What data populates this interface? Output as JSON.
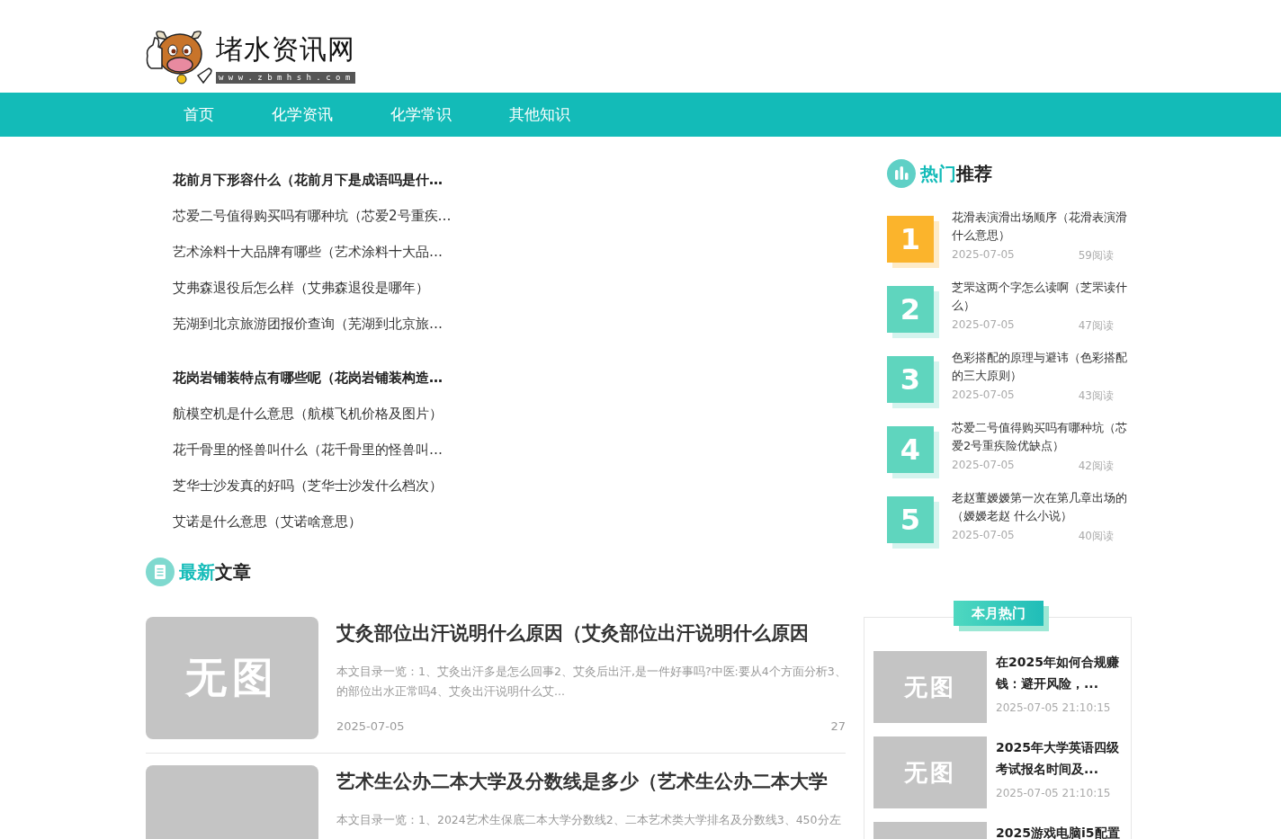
{
  "logo": {
    "name": "堵水资讯网",
    "domain": "w w w . z b m h s h . c o m"
  },
  "nav": [
    {
      "label": "首页"
    },
    {
      "label": "化学资讯"
    },
    {
      "label": "化学常识"
    },
    {
      "label": "其他知识"
    }
  ],
  "link_groups": [
    {
      "items": [
        {
          "text": "花前月下形容什么（花前月下是成语吗是什…",
          "bold": true
        },
        {
          "text": "芯爱二号值得购买吗有哪种坑（芯爱2号重疾…",
          "bold": false
        },
        {
          "text": "艺术涂料十大品牌有哪些（艺术涂料十大品…",
          "bold": false
        },
        {
          "text": "艾弗森退役后怎么样（艾弗森退役是哪年）",
          "bold": false
        },
        {
          "text": "芜湖到北京旅游团报价查询（芜湖到北京旅…",
          "bold": false
        }
      ]
    },
    {
      "items": [
        {
          "text": "花岗岩铺装特点有哪些呢（花岗岩铺装构造…",
          "bold": true
        },
        {
          "text": "航模空机是什么意思（航模飞机价格及图片）",
          "bold": false
        },
        {
          "text": "花千骨里的怪兽叫什么（花千骨里的怪兽叫…",
          "bold": false
        },
        {
          "text": "芝华士沙发真的好吗（芝华士沙发什么档次）",
          "bold": false
        },
        {
          "text": "艾诺是什么意思（艾诺啥意思）",
          "bold": false
        }
      ]
    }
  ],
  "latest": {
    "title_accent": "最新",
    "title_rest": "文章",
    "articles": [
      {
        "image_label": "无图",
        "title": "艾灸部位出汗说明什么原因（艾灸部位出汗说明什么原因",
        "excerpt_lines": [
          "本文目录一览：1、艾灸出汗多是怎么回事2、艾灸后出汗,是一件好事吗?中医:要从4个方面分析3、",
          "的部位出水正常吗4、艾灸出汗说明什么艾..."
        ],
        "date": "2025-07-05",
        "views": "27"
      },
      {
        "title": "艺术生公办二本大学及分数线是多少（艺术生公办二本大学",
        "excerpt_lines": [
          "本文目录一览：1、2024艺术生保底二本大学分数线2、二本艺术类大学排名及分数线3、450分左"
        ]
      }
    ]
  },
  "hot": {
    "title_accent": "热门",
    "title_rest": "推荐",
    "items": [
      {
        "rank": "1",
        "color": "#fbb42c",
        "title": "花滑表演滑出场顺序（花滑表演滑什么意思）",
        "date": "2025-07-05",
        "views": "59阅读"
      },
      {
        "rank": "2",
        "color": "#5fd5be",
        "title": "芝罘这两个字怎么读啊（芝罘读什么）",
        "date": "2025-07-05",
        "views": "47阅读"
      },
      {
        "rank": "3",
        "color": "#5fd5be",
        "title": "色彩搭配的原理与避讳（色彩搭配的三大原则）",
        "date": "2025-07-05",
        "views": "43阅读"
      },
      {
        "rank": "4",
        "color": "#5fd5be",
        "title": "芯爱二号值得购买吗有哪种坑（芯爱2号重疾险优缺点）",
        "date": "2025-07-05",
        "views": "42阅读"
      },
      {
        "rank": "5",
        "color": "#5fd5be",
        "title": "老赵董嫒嫒第一次在第几章出场的（嫒嫒老赵 什么小说）",
        "date": "2025-07-05",
        "views": "40阅读"
      }
    ]
  },
  "monthly": {
    "title": "本月热门",
    "items": [
      {
        "image_label": "无图",
        "title": "在2025年如何合规赚钱：避开风险，...",
        "time": "2025-07-05 21:10:15"
      },
      {
        "image_label": "无图",
        "title": "2025年大学英语四级考试报名时间及...",
        "time": "2025-07-05 21:10:15"
      },
      {
        "title": "2025游戏电脑i5配置"
      }
    ]
  }
}
